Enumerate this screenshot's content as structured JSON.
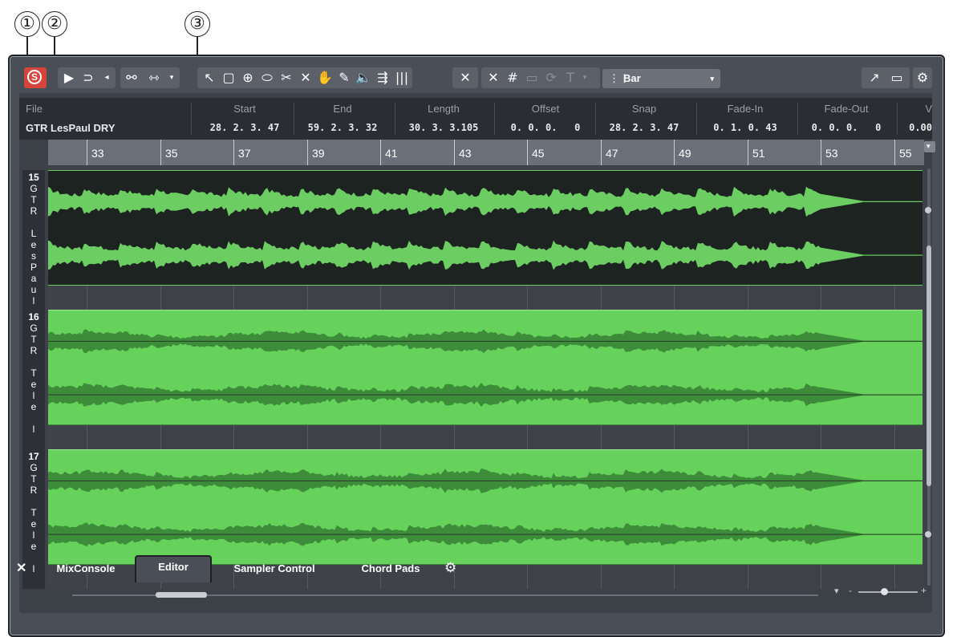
{
  "callouts": [
    "①",
    "②",
    "③"
  ],
  "toolbar": {
    "solo_label": "S",
    "snap_type": "Bar"
  },
  "info_line": {
    "file_header": "File",
    "file_value": "GTR LesPaul DRY",
    "fields": [
      {
        "header": "Start",
        "value": "28. 2. 3. 47"
      },
      {
        "header": "End",
        "value": "59. 2. 3. 32"
      },
      {
        "header": "Length",
        "value": "30. 3. 3.105"
      },
      {
        "header": "Offset",
        "value": "0. 0. 0.   0"
      },
      {
        "header": "Snap",
        "value": "28. 2. 3. 47"
      },
      {
        "header": "Fade-In",
        "value": "0. 1. 0. 43"
      },
      {
        "header": "Fade-Out",
        "value": "0. 0. 0.   0"
      },
      {
        "header": "V",
        "value": "0.00"
      }
    ]
  },
  "ruler": {
    "labels": [
      "33",
      "35",
      "37",
      "39",
      "41",
      "43",
      "45",
      "47",
      "49",
      "51",
      "53",
      "55"
    ]
  },
  "lanes": [
    {
      "number": "15",
      "name_chars": [
        "G",
        "T",
        "R",
        " ",
        "L",
        "e",
        "s",
        "P",
        "a",
        "u",
        "l"
      ],
      "selected": true
    },
    {
      "number": "16",
      "name_chars": [
        "G",
        "T",
        "R",
        " ",
        "T",
        "e",
        "l",
        "e",
        " ",
        "l"
      ],
      "selected": false
    },
    {
      "number": "17",
      "name_chars": [
        "G",
        "T",
        "R",
        " ",
        "T",
        "e",
        "l",
        "e",
        " ",
        "l"
      ],
      "selected": false
    }
  ],
  "zoom": {
    "minus": "-",
    "plus": "+"
  },
  "tabs": [
    {
      "label": "MixConsole",
      "active": false
    },
    {
      "label": "Editor",
      "active": true
    },
    {
      "label": "Sampler Control",
      "active": false
    },
    {
      "label": "Chord Pads",
      "active": false
    }
  ],
  "colors": {
    "solo": "#d6453c",
    "selected_clip_bg": "#1d2320",
    "selected_wave": "#6ccd62",
    "clip_bg": "#66d25c",
    "clip_wave": "#3c8c3a"
  }
}
